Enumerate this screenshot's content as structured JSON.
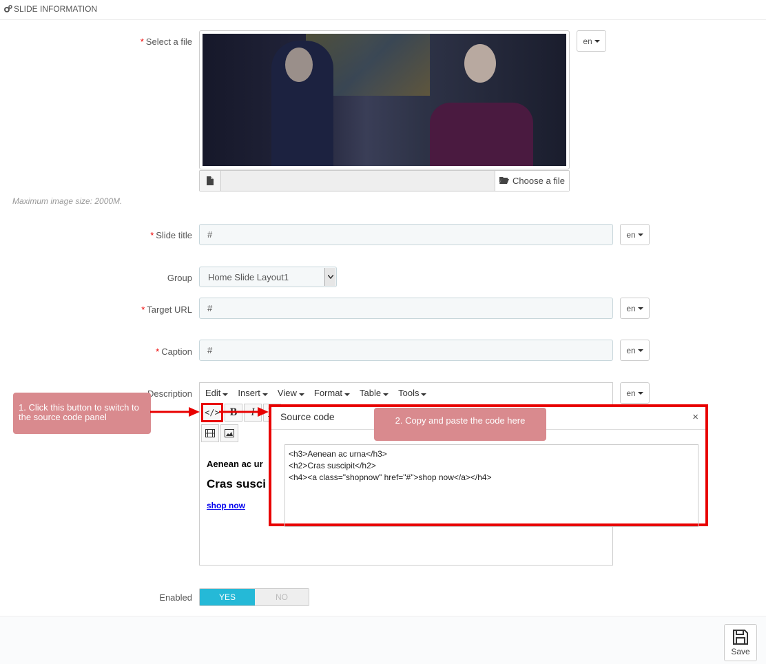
{
  "header": {
    "title": "SLIDE INFORMATION"
  },
  "fields": {
    "file": {
      "label": "Select a file",
      "choose_label": "Choose a file",
      "lang": "en"
    },
    "hint": "Maximum image size: 2000M.",
    "slide_title": {
      "label": "Slide title",
      "value": "#",
      "lang": "en"
    },
    "group": {
      "label": "Group",
      "value": "Home Slide Layout1"
    },
    "target_url": {
      "label": "Target URL",
      "value": "#",
      "lang": "en"
    },
    "caption": {
      "label": "Caption",
      "value": "#",
      "lang": "en"
    },
    "description": {
      "label": "Description",
      "lang": "en"
    },
    "enabled": {
      "label": "Enabled",
      "yes": "YES",
      "no": "NO"
    }
  },
  "editor": {
    "menu": [
      "Edit",
      "Insert",
      "View",
      "Format",
      "Table",
      "Tools"
    ],
    "content": {
      "h3": "Aenean ac ur",
      "h2": "Cras susci",
      "link": "shop now"
    }
  },
  "modal": {
    "title": "Source code",
    "close": "×",
    "code_lines": [
      "<h3>Aenean ac urna</h3>",
      "<h2>Cras suscipit</h2>",
      "<h4><a class=\"shopnow\" href=\"#\">shop now</a></h4>"
    ]
  },
  "callouts": {
    "step1": "1. Click this button to switch to the source code panel",
    "step2": "2. Copy and paste the code here"
  },
  "footer": {
    "save_label": "Save"
  },
  "colors": {
    "accent": "#25b9d7",
    "annotation_red": "#e80000",
    "callout": "#d98a8e"
  }
}
